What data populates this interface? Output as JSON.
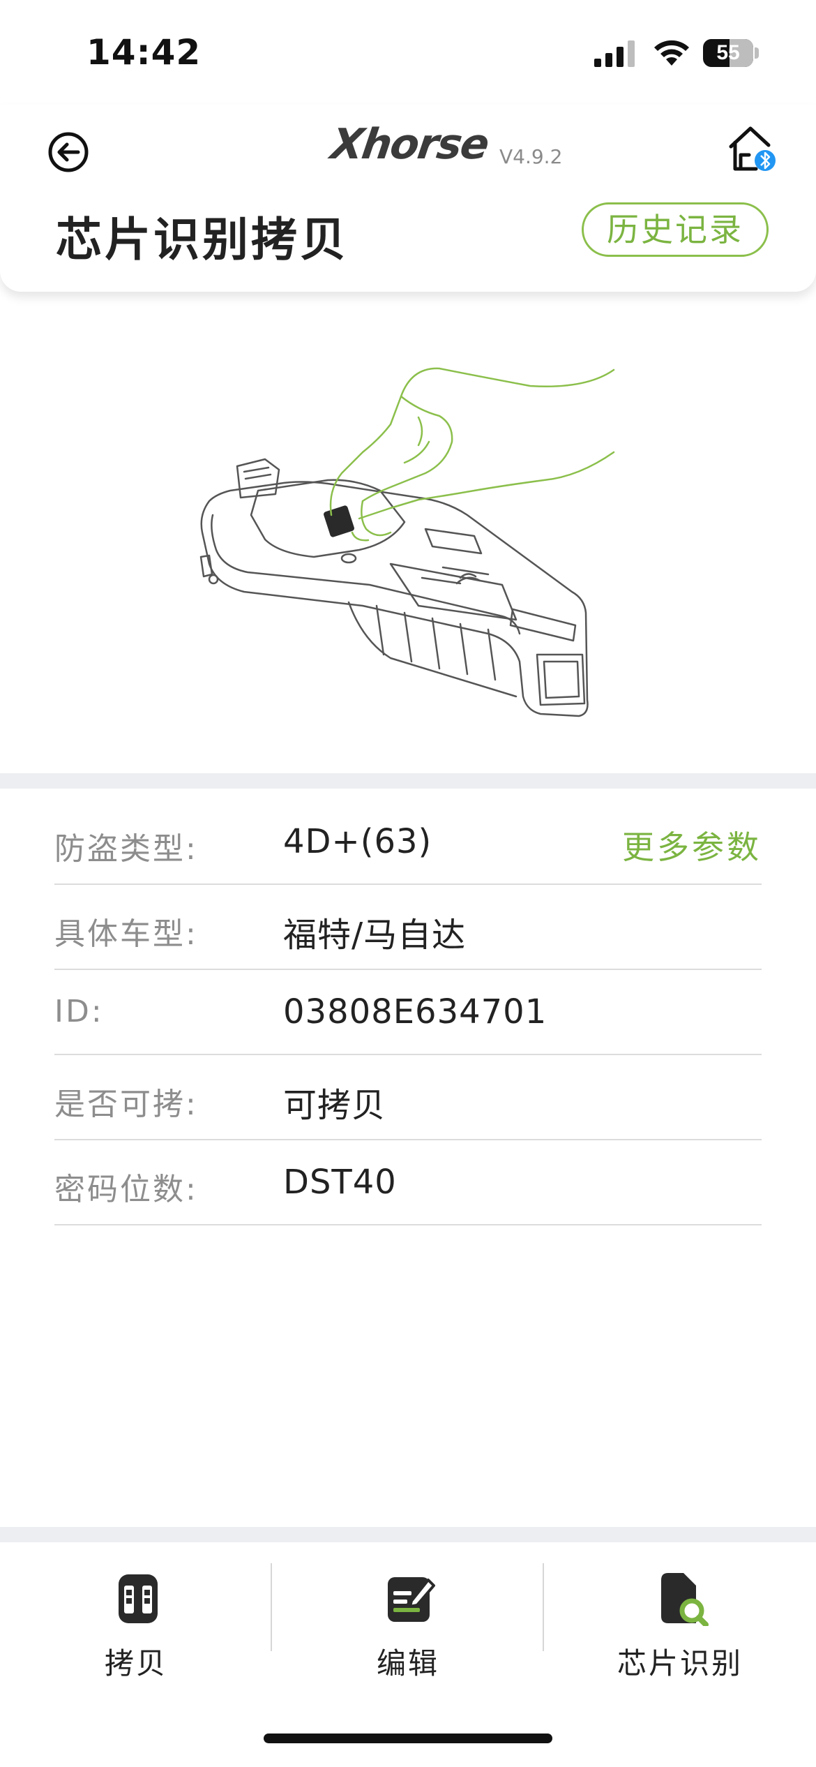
{
  "status_bar": {
    "time": "14:42",
    "battery_level": "55"
  },
  "header": {
    "brand": "Xhorse",
    "version": "V4.9.2",
    "title": "芯片识别拷贝",
    "history_button": "历史记录",
    "icons": {
      "back": "back-circle-icon",
      "home": "home-bluetooth-icon"
    }
  },
  "info": {
    "more_params": "更多参数",
    "rows": [
      {
        "label": "防盗类型:",
        "value": "4D+(63)"
      },
      {
        "label": "具体车型:",
        "value": "福特/马自达"
      },
      {
        "label": "ID:",
        "value": "03808E634701"
      },
      {
        "label": "是否可拷:",
        "value": "可拷贝"
      },
      {
        "label": "密码位数:",
        "value": "DST40"
      }
    ]
  },
  "tabs": [
    {
      "label": "拷贝",
      "icon": "car-key-icon"
    },
    {
      "label": "编辑",
      "icon": "edit-icon"
    },
    {
      "label": "芯片识别",
      "icon": "chip-search-icon"
    }
  ],
  "colors": {
    "accent": "#7bb441",
    "text": "#222222",
    "muted": "#8d8d8d",
    "bluetooth": "#2196f3"
  }
}
